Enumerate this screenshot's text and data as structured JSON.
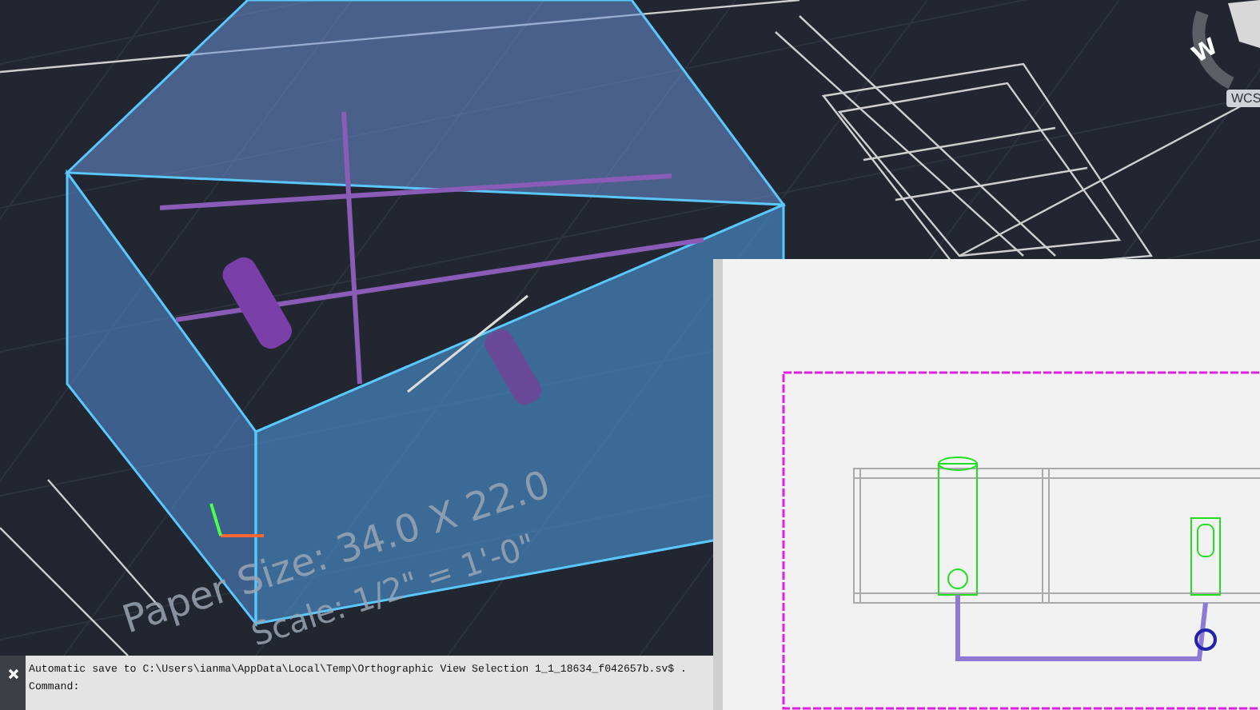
{
  "viewport": {
    "paper_size": "Paper Size: 34.0 X 22.0",
    "scale": "Scale: 1/2\" = 1'-0\""
  },
  "viewcube": {
    "direction": "W",
    "ucs_button": "WCS"
  },
  "command_line": {
    "history": [
      "Automatic save to C:\\Users\\ianma\\AppData\\Local\\Temp\\Orthographic View Selection 1_1_18634_f042657b.sv$ ."
    ],
    "prompt": "Command:"
  }
}
